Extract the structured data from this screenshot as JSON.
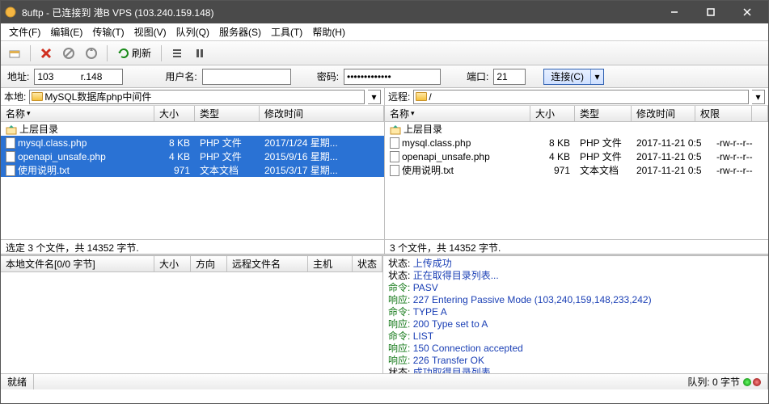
{
  "title": "8uftp - 已连接到 港B VPS (103.240.159.148)",
  "menu": [
    "文件(F)",
    "编辑(E)",
    "传输(T)",
    "视图(V)",
    "队列(Q)",
    "服务器(S)",
    "工具(T)",
    "帮助(H)"
  ],
  "toolbar": {
    "refresh": "刷新"
  },
  "conn": {
    "addr_label": "地址:",
    "addr": "103          r.148",
    "user_label": "用户名:",
    "user": "",
    "pass_label": "密码:",
    "pass": "*************",
    "port_label": "端口:",
    "port": "21",
    "connect": "连接(C)"
  },
  "local": {
    "label": "本地:",
    "path": "MySQL数据库php中间件",
    "cols": [
      "名称",
      "大小",
      "类型",
      "修改时间"
    ],
    "parent": "上层目录",
    "rows": [
      {
        "name": "mysql.class.php",
        "size": "8 KB",
        "type": "PHP 文件",
        "date": "2017/1/24 星期..."
      },
      {
        "name": "openapi_unsafe.php",
        "size": "4 KB",
        "type": "PHP 文件",
        "date": "2015/9/16 星期..."
      },
      {
        "name": "使用说明.txt",
        "size": "971",
        "type": "文本文档",
        "date": "2015/3/17 星期..."
      }
    ],
    "status": "选定 3 个文件，共 14352 字节."
  },
  "remote": {
    "label": "远程:",
    "path": "/",
    "cols": [
      "名称",
      "大小",
      "类型",
      "修改时间",
      "权限"
    ],
    "parent": "上层目录",
    "rows": [
      {
        "name": "mysql.class.php",
        "size": "8 KB",
        "type": "PHP 文件",
        "date": "2017-11-21 0:5",
        "perm": "-rw-r--r--"
      },
      {
        "name": "openapi_unsafe.php",
        "size": "4 KB",
        "type": "PHP 文件",
        "date": "2017-11-21 0:5",
        "perm": "-rw-r--r--"
      },
      {
        "name": "使用说明.txt",
        "size": "971",
        "type": "文本文档",
        "date": "2017-11-21 0:5",
        "perm": "-rw-r--r--"
      }
    ],
    "status": "3 个文件，共 14352 字节."
  },
  "queue": {
    "cols": [
      "本地文件名[0/0 字节]",
      "大小",
      "方向",
      "远程文件名",
      "主机",
      "状态"
    ]
  },
  "log": [
    {
      "k": "status",
      "label": "状态:",
      "text": "上传成功"
    },
    {
      "k": "status",
      "label": "状态:",
      "text": "正在取得目录列表..."
    },
    {
      "k": "cmd",
      "label": "命令:",
      "text": "PASV"
    },
    {
      "k": "resp",
      "label": "响应:",
      "text": "227 Entering Passive Mode (103,240,159,148,233,242)"
    },
    {
      "k": "cmd",
      "label": "命令:",
      "text": "TYPE A"
    },
    {
      "k": "resp",
      "label": "响应:",
      "text": "200 Type set to A"
    },
    {
      "k": "cmd",
      "label": "命令:",
      "text": "LIST"
    },
    {
      "k": "resp",
      "label": "响应:",
      "text": "150 Connection accepted"
    },
    {
      "k": "resp",
      "label": "响应:",
      "text": "226 Transfer OK"
    },
    {
      "k": "status",
      "label": "状态:",
      "text": "成功取得目录列表"
    }
  ],
  "statusbar": {
    "ready": "就绪",
    "queue": "队列: 0 字节"
  }
}
